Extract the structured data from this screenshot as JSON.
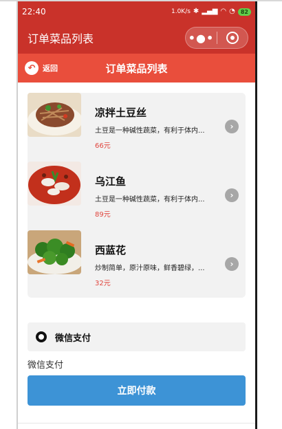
{
  "status_bar": {
    "time": "22:40",
    "speed": "1.0K/s",
    "battery": "82"
  },
  "nav": {
    "title": "订单菜品列表",
    "more_symbol": "•●•"
  },
  "sub_header": {
    "back_label": "返回",
    "title": "订单菜品列表"
  },
  "dishes": [
    {
      "name": "凉拌土豆丝",
      "desc": "土豆是一种碱性蔬菜，有利于体内...",
      "price": "66元",
      "image_icon": "shredded-potato-dish"
    },
    {
      "name": "乌江鱼",
      "desc": "土豆是一种碱性蔬菜，有利于体内...",
      "price": "89元",
      "image_icon": "spicy-fish-dish"
    },
    {
      "name": "西蓝花",
      "desc": "炒制简单，原汁原味，鲜香碧绿，...",
      "price": "32元",
      "image_icon": "broccoli-dish"
    }
  ],
  "payment": {
    "option_label": "微信支付",
    "caption": "微信支付",
    "button_label": "立即付款"
  },
  "colors": {
    "nav_red": "#c9322a",
    "subheader_red": "#e94e3c",
    "price_red": "#e0443c",
    "pay_blue": "#3d93d6"
  }
}
